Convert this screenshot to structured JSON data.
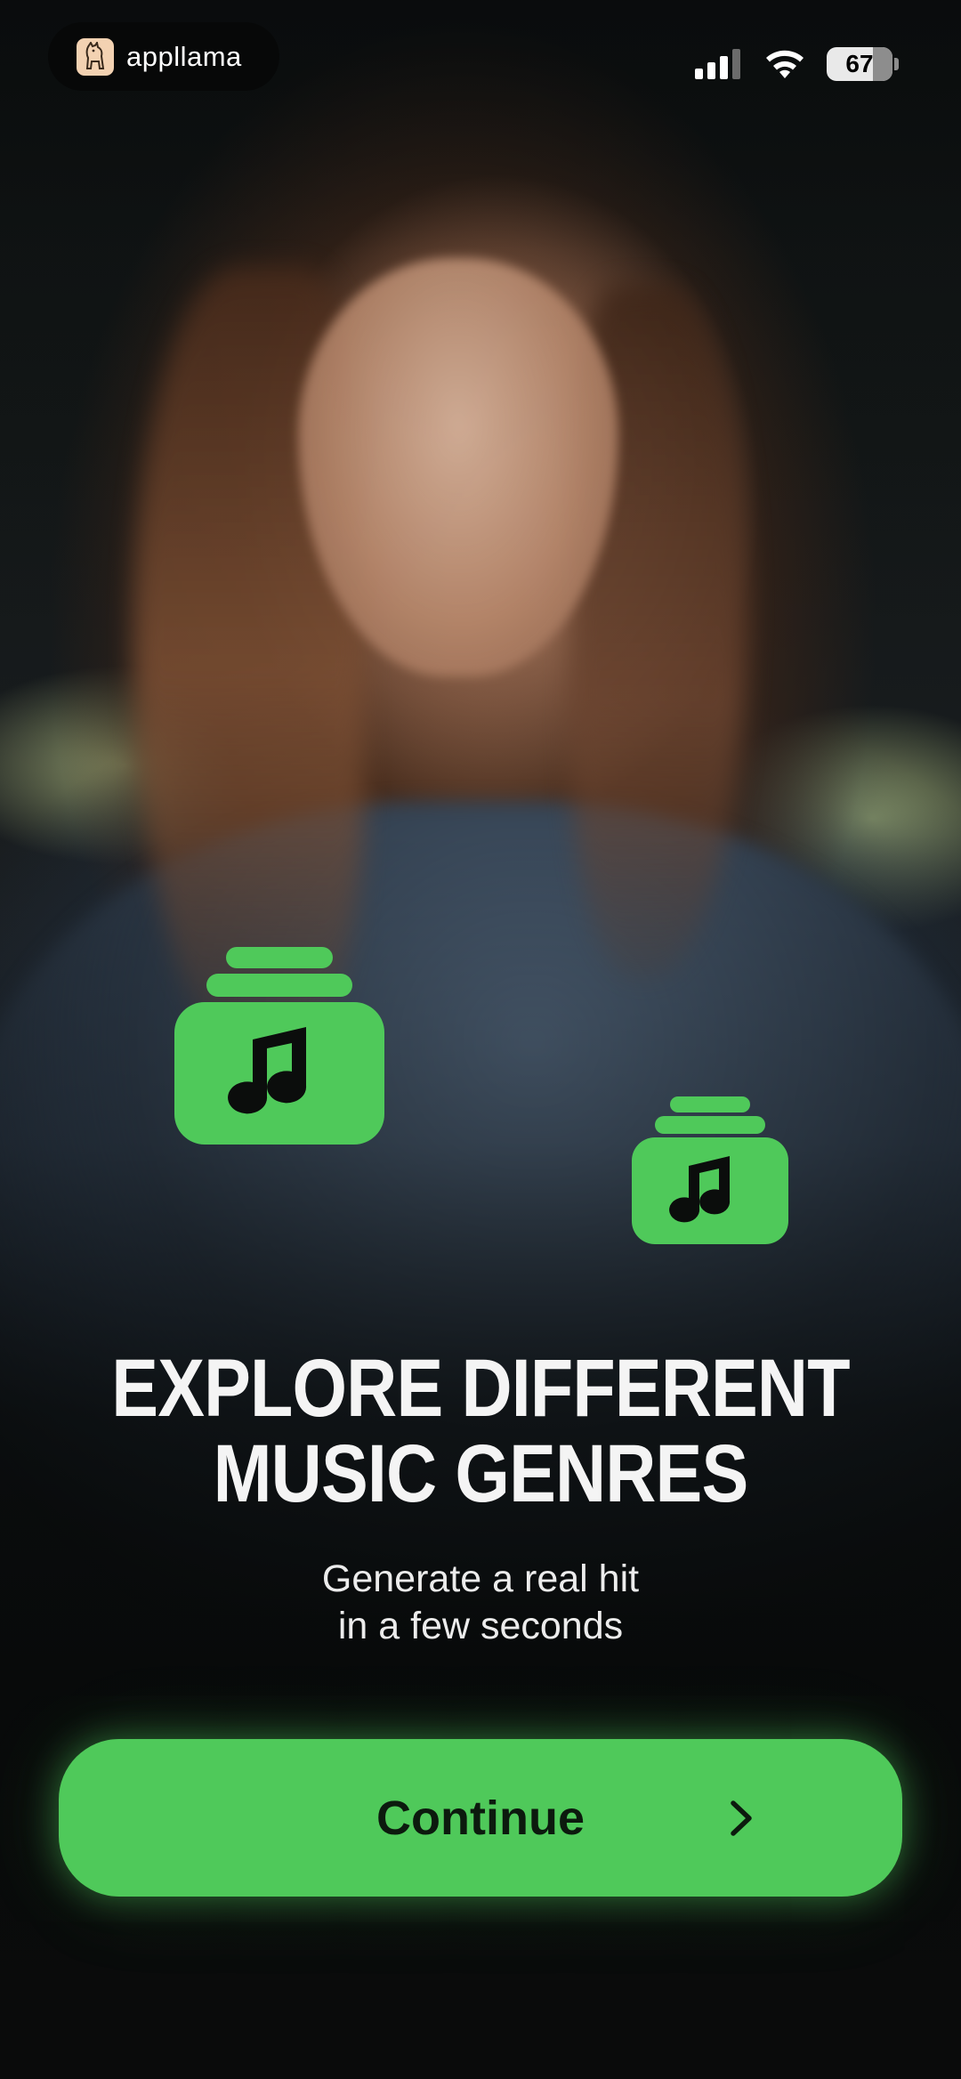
{
  "status_bar": {
    "brand": "appllama",
    "battery": "67",
    "icons": [
      "cellular-signal-icon",
      "wifi-icon",
      "battery-icon"
    ]
  },
  "slide": {
    "title_line1": "EXPLORE DIFFERENT",
    "title_line2": "MUSIC GENRES",
    "subtitle_line1": "Generate a real hit",
    "subtitle_line2": "in a few seconds",
    "icons": [
      "music-album-icon",
      "music-album-icon"
    ]
  },
  "cta": {
    "label": "Continue",
    "icon": "chevron-right-icon"
  },
  "colors": {
    "accent": "#4fc95a",
    "background": "#0b0d0c",
    "text": "#f4f4f4"
  }
}
